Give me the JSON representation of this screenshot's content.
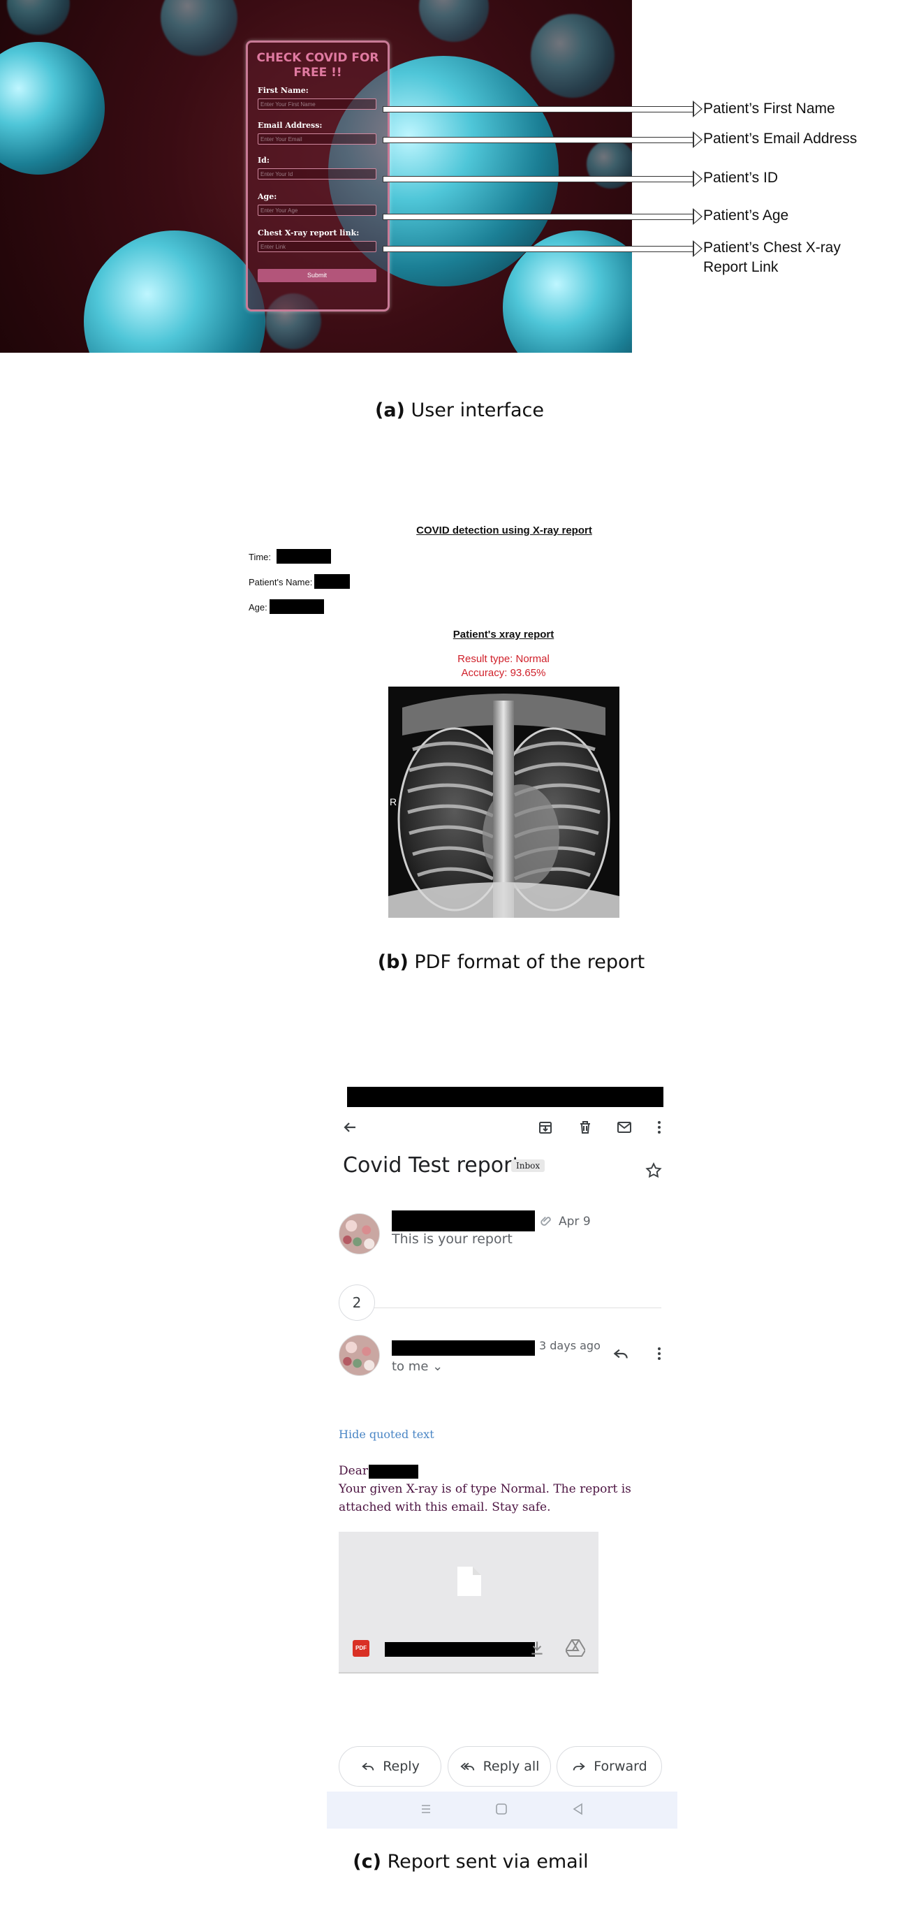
{
  "panel_a": {
    "form": {
      "title": "CHECK COVID FOR FREE !!",
      "fields": [
        {
          "label": "First Name:",
          "placeholder": "Enter Your First Name"
        },
        {
          "label": "Email Address:",
          "placeholder": "Enter Your Email"
        },
        {
          "label": "Id:",
          "placeholder": "Enter Your Id"
        },
        {
          "label": "Age:",
          "placeholder": "Enter Your Age"
        },
        {
          "label": "Chest X-ray report link:",
          "placeholder": "Enter Link"
        }
      ],
      "submit_label": "Submit"
    },
    "callouts": [
      "Patient’s First Name",
      "Patient’s Email Address",
      "Patient’s ID",
      "Patient’s Age",
      "Patient’s Chest X-ray Report Link"
    ],
    "caption_letter": "(a)",
    "caption_text": " User interface"
  },
  "panel_b": {
    "title": "COVID detection using X-ray report",
    "time_label": "Time:",
    "name_label": "Patient's Name:",
    "age_label": "Age:",
    "xray_title": "Patient's xray report",
    "result": "Result type: Normal",
    "accuracy": "Accuracy: 93.65%",
    "xray_marker": "R",
    "caption_letter": "(b)",
    "caption_text": " PDF format of the report"
  },
  "panel_c": {
    "subject": "Covid Test report",
    "label_badge": "Inbox",
    "msg1": {
      "date": "Apr 9",
      "snippet": "This is your report"
    },
    "collapsed_count": "2",
    "msg2": {
      "date": "3 days ago",
      "recipient": "to me"
    },
    "hide_quoted": "Hide quoted text",
    "greeting": "Dear",
    "body": "Your given X-ray is of type Normal. The report is attached with this email. Stay safe.",
    "attachment_type": "PDF",
    "actions": {
      "reply": "Reply",
      "reply_all": "Reply all",
      "forward": "Forward"
    },
    "caption_letter": "(c)",
    "caption_text": " Report sent via email"
  }
}
